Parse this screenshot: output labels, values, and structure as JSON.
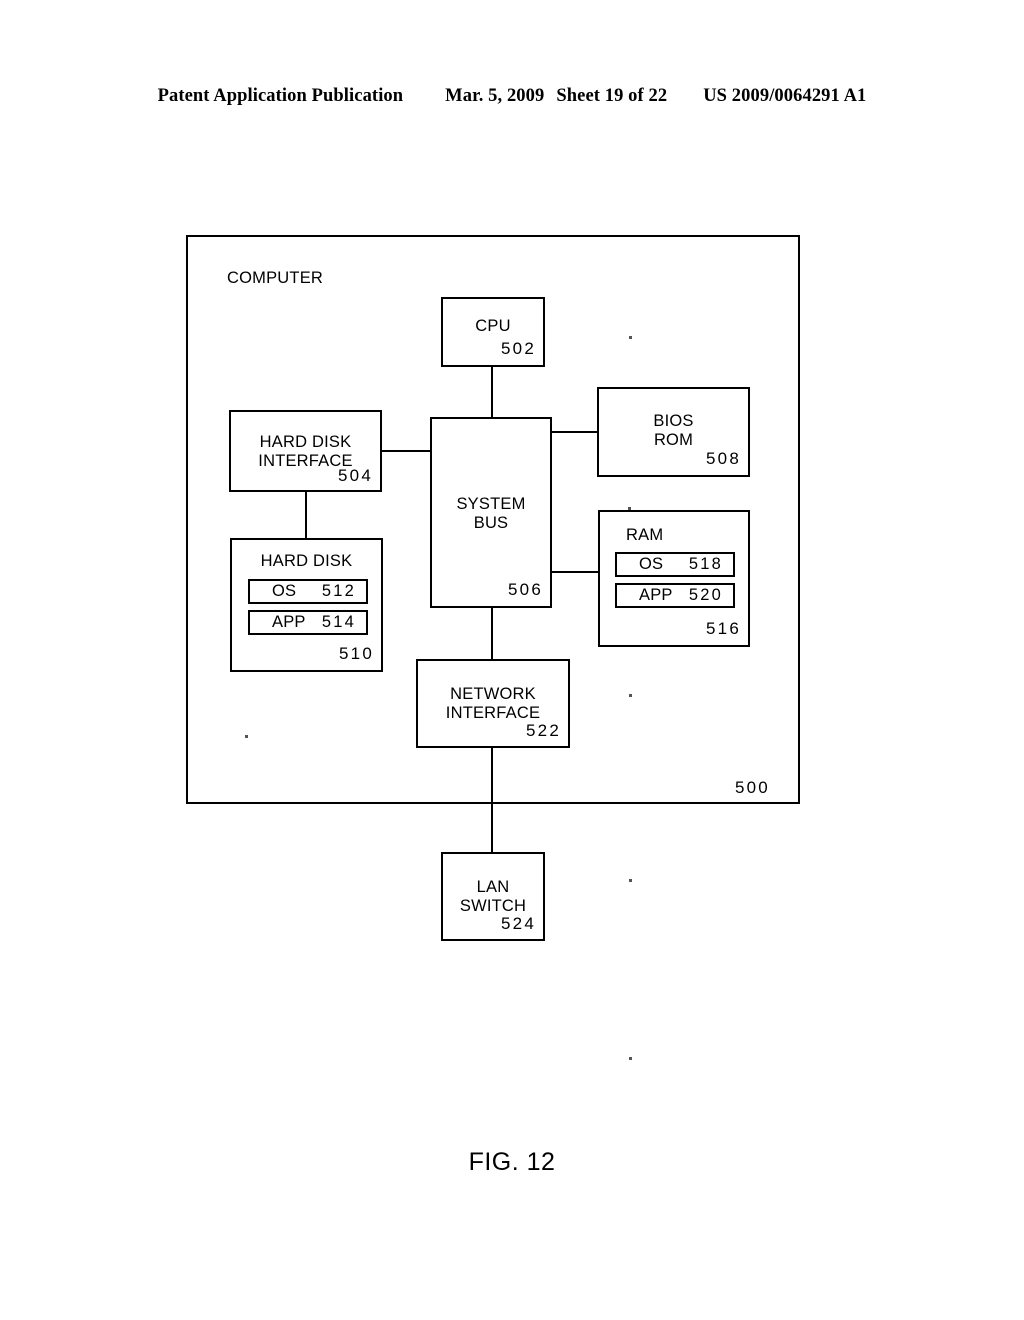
{
  "header": {
    "publication": "Patent Application Publication",
    "date": "Mar. 5, 2009",
    "sheet": "Sheet 19 of 22",
    "doc_number": "US 2009/0064291 A1"
  },
  "figure": {
    "caption": "FIG. 12",
    "outer": {
      "title": "COMPUTER",
      "ref": "500"
    },
    "blocks": {
      "cpu": {
        "label": "CPU",
        "ref": "502"
      },
      "hd_iface": {
        "label_line1": "HARD DISK",
        "label_line2": "INTERFACE",
        "ref": "504"
      },
      "system_bus": {
        "label_line1": "SYSTEM",
        "label_line2": "BUS",
        "ref": "506"
      },
      "bios_rom": {
        "label_line1": "BIOS",
        "label_line2": "ROM",
        "ref": "508"
      },
      "hard_disk": {
        "label": "HARD DISK",
        "ref": "510",
        "slots": [
          {
            "name": "OS",
            "ref": "512"
          },
          {
            "name": "APP",
            "ref": "514"
          }
        ]
      },
      "ram": {
        "label": "RAM",
        "ref": "516",
        "slots": [
          {
            "name": "OS",
            "ref": "518"
          },
          {
            "name": "APP",
            "ref": "520"
          }
        ]
      },
      "net_iface": {
        "label_line1": "NETWORK",
        "label_line2": "INTERFACE",
        "ref": "522"
      },
      "lan_switch": {
        "label_line1": "LAN",
        "label_line2": "SWITCH",
        "ref": "524"
      }
    },
    "connections": [
      {
        "from": "cpu",
        "to": "system_bus"
      },
      {
        "from": "hd_iface",
        "to": "system_bus"
      },
      {
        "from": "hd_iface",
        "to": "hard_disk"
      },
      {
        "from": "system_bus",
        "to": "bios_rom"
      },
      {
        "from": "system_bus",
        "to": "ram"
      },
      {
        "from": "system_bus",
        "to": "net_iface"
      },
      {
        "from": "net_iface",
        "to": "lan_switch"
      }
    ]
  },
  "colors": {
    "ink": "#000000",
    "paper": "#ffffff"
  }
}
